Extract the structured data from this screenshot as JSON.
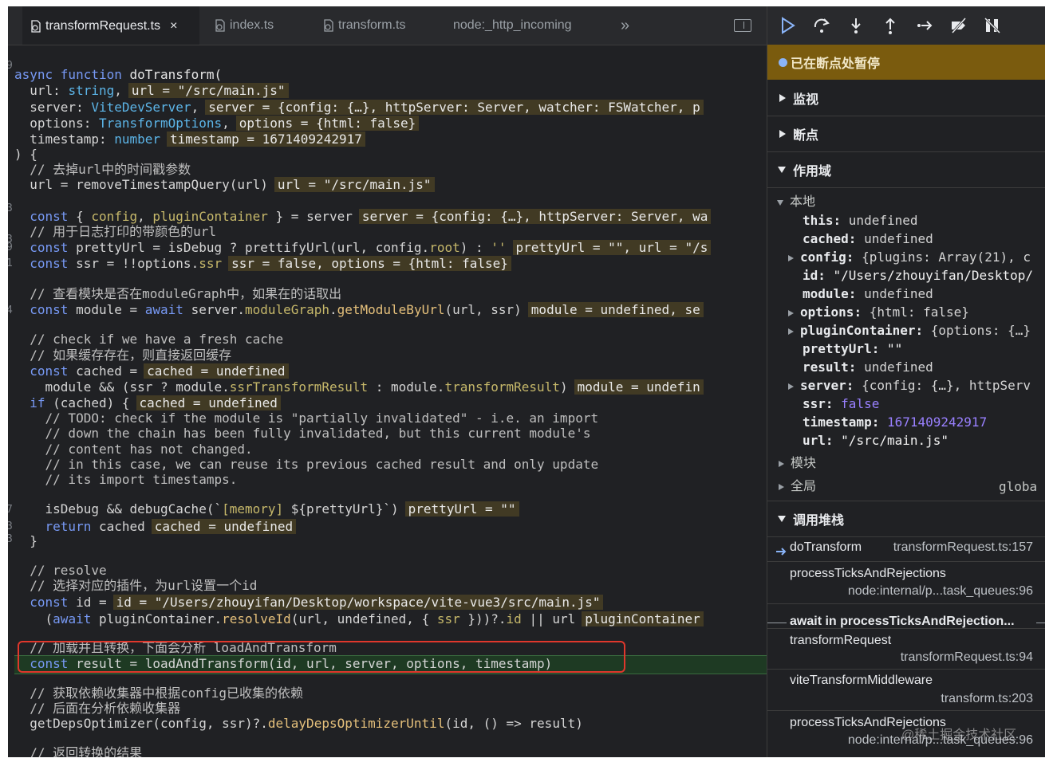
{
  "tabs": [
    {
      "label": "transformRequest.ts",
      "close": "×"
    },
    {
      "label": "index.ts"
    },
    {
      "label": "transform.ts"
    },
    {
      "label": "node:_http_incoming"
    },
    {
      "label": "»"
    }
  ],
  "gutter": [
    "9",
    "3",
    "3",
    "9",
    "1",
    "4",
    "7",
    "3",
    "3"
  ],
  "code": {
    "l1": {
      "kw": "async function ",
      "fn": "doTransform("
    },
    "l2": {
      "a": "  url: ",
      "t": "string",
      "b": ",",
      "inl": "url = \"/src/main.js\""
    },
    "l3": {
      "a": "  server: ",
      "t": "ViteDevServer",
      "b": ",",
      "inl": "server = {config: {…}, httpServer: Server, watcher: FSWatcher, p"
    },
    "l4": {
      "a": "  options: ",
      "t": "TransformOptions",
      "b": ",",
      "inl": "options = {html: false}"
    },
    "l5": {
      "a": "  timestamp: ",
      "t": "number",
      "inl": "timestamp = 1671409242917"
    },
    "l6": {
      "a": ") {"
    },
    "l7": {
      "c": "  // 去掉url中的时间戳参数"
    },
    "l8": {
      "a": "  url = removeTimestampQuery(url)",
      "inl": "url = \"/src/main.js\""
    },
    "l9": {
      "k": "  const",
      "a1": " { ",
      "p1": "config",
      "a2": ", ",
      "p2": "pluginContainer",
      "a3": " } = server",
      "inl": "server = {config: {…}, httpServer: Server, wa"
    },
    "l10": {
      "c": "  // 用于日志打印的带颜色的url"
    },
    "l11": {
      "k": "  const",
      "a1": " prettyUrl = isDebug ? prettifyUrl(url, config.",
      "p": "root",
      "a2": ") : ",
      "s": "''",
      "inl": "prettyUrl = \"\", url = \"/s"
    },
    "l12": {
      "k": "  const",
      "a1": " ssr = !!options.",
      "p": "ssr",
      "inl": "ssr = false, options = {html: false}"
    },
    "l13": {
      "c": "  // 查看模块是否在moduleGraph中，如果在的话取出"
    },
    "l14": {
      "k": "  const",
      "a1": " module = ",
      "k2": "await",
      "a2": " server.",
      "p1": "moduleGraph",
      "a3": ".",
      "f": "getModuleByUrl",
      "a4": "(url, ssr)",
      "inl": "module = undefined, se"
    },
    "l15": {
      "c": "  // check if we have a fresh cache"
    },
    "l16": {
      "c": "  // 如果缓存存在，则直接返回缓存"
    },
    "l17": {
      "k": "  const",
      "a1": " cached =",
      "inl": "cached = undefined"
    },
    "l18": {
      "a1": "    module && (ssr ? module.",
      "p1": "ssrTransformResult",
      "a2": " : module.",
      "p2": "transformResult",
      "a3": ")",
      "inl": "module = undefin"
    },
    "l19": {
      "k": "  if",
      "a1": " (cached) {",
      "inl": "cached = undefined"
    },
    "l20": {
      "c": "    // TODO: check if the module is \"partially invalidated\" - i.e. an import"
    },
    "l21": {
      "c": "    // down the chain has been fully invalidated, but this current module's"
    },
    "l22": {
      "c": "    // content has not changed."
    },
    "l23": {
      "c": "    // in this case, we can reuse its previous cached result and only update"
    },
    "l24": {
      "c": "    // its import timestamps."
    },
    "l25": {
      "a1": "    isDebug && debugCache(`",
      "p": "[memory]",
      "a2": " ${prettyUrl}`)",
      "inl": "prettyUrl = \"\""
    },
    "l26": {
      "k": "    return",
      "a1": " cached",
      "inl": "cached = undefined"
    },
    "l27": {
      "a": "  }"
    },
    "l28": {
      "c": "  // resolve"
    },
    "l29": {
      "c": "  // 选择对应的插件，为url设置一个id"
    },
    "l30": {
      "k": "  const",
      "a1": " id =",
      "inl": "id = \"/Users/zhouyifan/Desktop/workspace/vite-vue3/src/main.js\""
    },
    "l31": {
      "a0": "    (",
      "k": "await",
      "a1": " pluginContainer.",
      "f": "resolveId",
      "a2": "(url, undefined, { ",
      "p": "ssr",
      "a3": " }))?.",
      "p2": "id",
      "a4": " || url",
      "inl": "pluginContainer"
    },
    "l32": {
      "c": "  // 加载并且转换，下面会分析 loadAndTransform"
    },
    "l33": {
      "k": "  const",
      "a1": " result = loadAndTransform(id, url, server, options, timestamp)"
    },
    "l34": {
      "c": "  // 获取依赖收集器中根据config已收集的依赖"
    },
    "l35": {
      "c": "  // 后面在分析依赖收集器"
    },
    "l36": {
      "a1": "  getDepsOptimizer(config, ssr)?.",
      "f": "delayDepsOptimizerUntil",
      "a2": "(id, () => result)"
    },
    "l37": {
      "c": "  // 返回转换的结果"
    }
  },
  "debugger": {
    "paused": "已在断点处暂停",
    "sections": {
      "watch": "监视",
      "breakpoints": "断点",
      "scope": "作用域",
      "callstack": "调用堆栈"
    },
    "local": "本地",
    "module_group": "模块",
    "global_group": "全局",
    "global_value": "globa",
    "scope_vars": [
      {
        "k": "this",
        "v": "undefined",
        "type": "plain"
      },
      {
        "k": "cached",
        "v": "undefined",
        "type": "plain"
      },
      {
        "k": "config",
        "v": "{plugins: Array(21), c",
        "type": "obj",
        "exp": true
      },
      {
        "k": "id",
        "v": "\"/Users/zhouyifan/Desktop/",
        "type": "str"
      },
      {
        "k": "module",
        "v": "undefined",
        "type": "plain"
      },
      {
        "k": "options",
        "v": "{html: false}",
        "type": "obj",
        "exp": true
      },
      {
        "k": "pluginContainer",
        "v": "{options: {…}",
        "type": "obj",
        "exp": true
      },
      {
        "k": "prettyUrl",
        "v": "\"\"",
        "type": "str"
      },
      {
        "k": "result",
        "v": "undefined",
        "type": "plain"
      },
      {
        "k": "server",
        "v": "{config: {…}, httpServ",
        "type": "obj",
        "exp": true
      },
      {
        "k": "ssr",
        "v": "false",
        "type": "bool"
      },
      {
        "k": "timestamp",
        "v": "1671409242917",
        "type": "bool"
      },
      {
        "k": "url",
        "v": "\"/src/main.js\"",
        "type": "str"
      }
    ],
    "frames": [
      {
        "name": "doTransform",
        "loc": "transformRequest.ts:157"
      },
      {
        "name": "processTicksAndRejections",
        "loc": "node:internal/p...task_queues:96"
      },
      {
        "name": "await in processTicksAndRejection..."
      },
      {
        "name": "transformRequest",
        "loc": "transformRequest.ts:94"
      },
      {
        "name": "viteTransformMiddleware",
        "loc": "transform.ts:203"
      },
      {
        "name": "processTicksAndRejections",
        "loc": "node:internal/p...task_queues:96"
      }
    ]
  },
  "watermark": "@稀土掘金技术社区",
  "colors": {
    "paused_bg": "#7a5b0e",
    "highlight": "#1e3a23",
    "red_box": "#e0372c"
  }
}
